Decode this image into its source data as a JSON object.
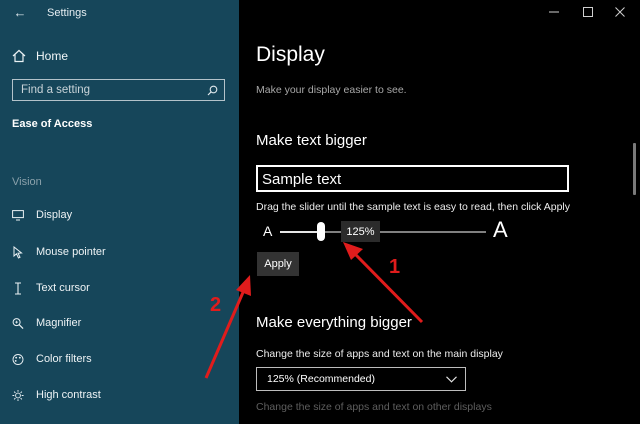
{
  "window": {
    "title": "Settings"
  },
  "sidebar": {
    "home_label": "Home",
    "search_placeholder": "Find a setting",
    "section_title": "Ease of Access",
    "group_label": "Vision",
    "items": [
      {
        "label": "Display",
        "icon": "monitor-icon"
      },
      {
        "label": "Mouse pointer",
        "icon": "mouse-pointer-icon"
      },
      {
        "label": "Text cursor",
        "icon": "text-cursor-icon"
      },
      {
        "label": "Magnifier",
        "icon": "magnifier-icon"
      },
      {
        "label": "Color filters",
        "icon": "color-filters-icon"
      },
      {
        "label": "High contrast",
        "icon": "high-contrast-icon"
      }
    ]
  },
  "main": {
    "page_title": "Display",
    "subtitle": "Make your display easier to see.",
    "text_section": {
      "heading": "Make text bigger",
      "sample_text": "Sample text",
      "instruction": "Drag the slider until the sample text is easy to read, then click Apply",
      "slider_min_label": "A",
      "slider_max_label": "A",
      "slider_value_label": "125%",
      "slider_fraction": 0.2,
      "apply_label": "Apply"
    },
    "everything_section": {
      "heading": "Make everything bigger",
      "main_display_label": "Change the size of apps and text on the main display",
      "dropdown_value": "125% (Recommended)",
      "other_displays_label": "Change the size of apps and text on other displays"
    }
  },
  "annotations": {
    "arrow_1_label": "1",
    "arrow_2_label": "2",
    "color": "#e01c1c"
  },
  "colors": {
    "sidebar_bg": "#16465a",
    "main_bg": "#000000"
  }
}
